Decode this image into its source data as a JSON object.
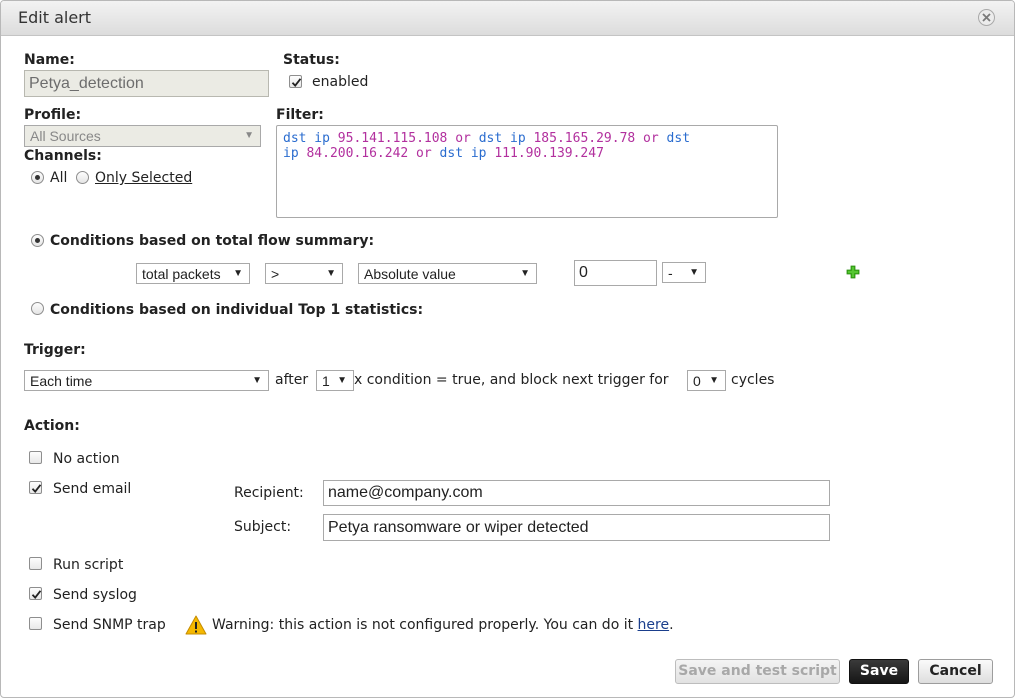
{
  "dialog": {
    "title": "Edit alert"
  },
  "name": {
    "label": "Name:",
    "value": "Petya_detection"
  },
  "status": {
    "label": "Status:",
    "option": "enabled",
    "checked": true
  },
  "profile": {
    "label": "Profile:",
    "value": "All Sources"
  },
  "channels": {
    "label": "Channels:",
    "all": "All",
    "only_selected": "Only Selected",
    "selected": "All"
  },
  "filter": {
    "label": "Filter:",
    "tokens": [
      [
        "kw",
        "dst ip "
      ],
      [
        "num",
        "95.141.115.108"
      ],
      [
        "op",
        " or "
      ],
      [
        "kw",
        "dst ip "
      ],
      [
        "num",
        "185.165.29.78"
      ],
      [
        "op",
        " or "
      ],
      [
        "kw",
        "dst"
      ],
      [
        "br",
        ""
      ],
      [
        "kw",
        "ip "
      ],
      [
        "num",
        "84.200.16.242"
      ],
      [
        "op",
        " or "
      ],
      [
        "kw",
        "dst ip "
      ],
      [
        "num",
        "111.90.139.247"
      ]
    ]
  },
  "conditions": {
    "total_label": "Conditions based on total flow summary:",
    "top_label": "Conditions based on individual Top 1 statistics:",
    "selected": "total",
    "metric": "total packets",
    "operator": ">",
    "mode": "Absolute value",
    "value": "0",
    "unit": "-"
  },
  "trigger": {
    "label": "Trigger:",
    "mode": "Each time",
    "after": "after",
    "count": "1",
    "condition_text": "x condition = true, and block next trigger for",
    "block": "0",
    "cycles": "cycles"
  },
  "action": {
    "label": "Action:",
    "no_action": {
      "label": "No action",
      "checked": false
    },
    "send_email": {
      "label": "Send email",
      "checked": true
    },
    "recipient_label": "Recipient:",
    "recipient": "name@company.com",
    "subject_label": "Subject:",
    "subject": "Petya ransomware or wiper detected",
    "run_script": {
      "label": "Run script",
      "checked": false
    },
    "send_syslog": {
      "label": "Send syslog",
      "checked": true
    },
    "send_snmp": {
      "label": "Send SNMP trap",
      "checked": false
    },
    "warning_text": "Warning: this action is not configured properly. You can do it",
    "warning_link": "here",
    "warning_end": "."
  },
  "buttons": {
    "save_test": "Save and test script",
    "save": "Save",
    "cancel": "Cancel"
  },
  "colors": {
    "keyword": "#2a6ccf",
    "value": "#b2309e",
    "add": "#3cb21a",
    "warning": "#f5b800"
  },
  "icons": {
    "close": "close-icon",
    "add": "plus-icon",
    "warning": "warning-triangle-icon",
    "dropdown": "chevron-down-icon"
  }
}
